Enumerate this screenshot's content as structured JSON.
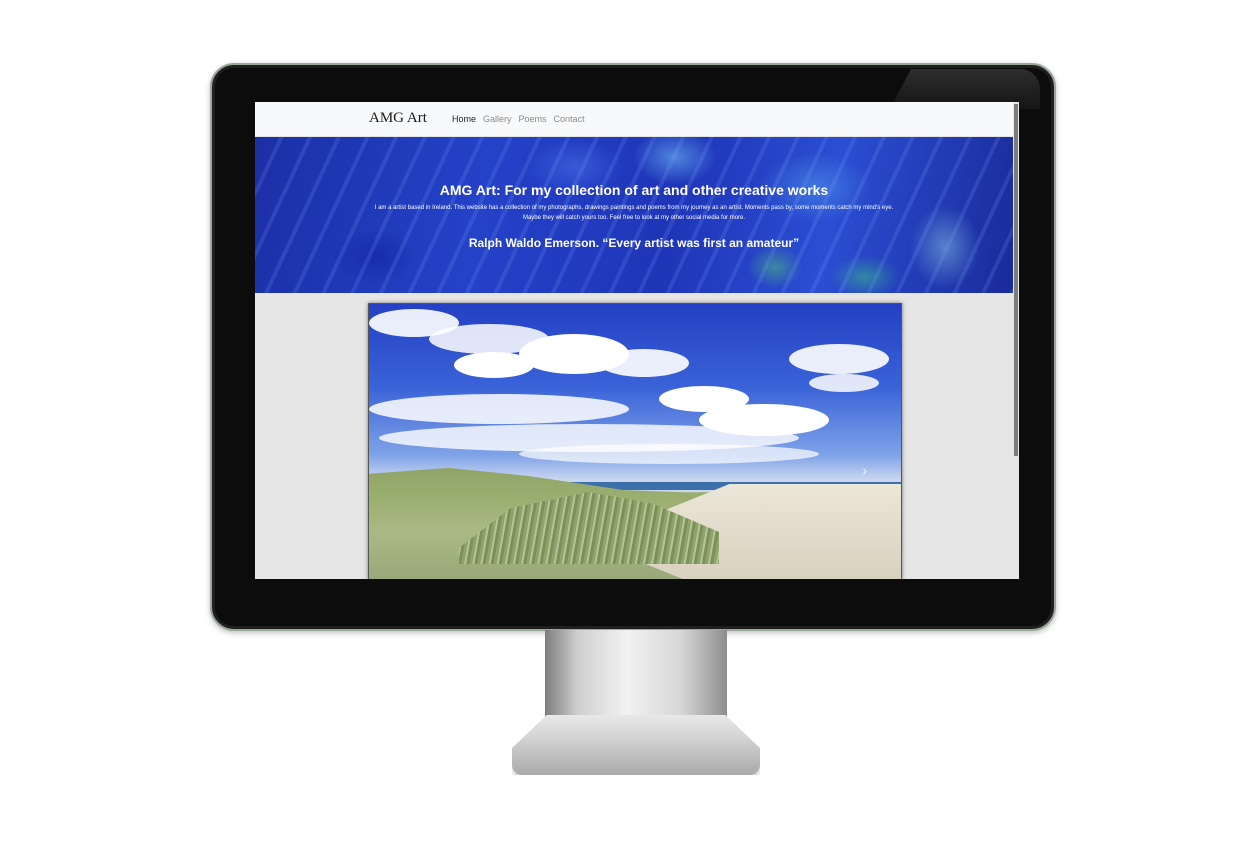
{
  "site": {
    "brand": "AMG Art",
    "nav": [
      {
        "label": "Home"
      },
      {
        "label": "Gallery"
      },
      {
        "label": "Poems"
      },
      {
        "label": "Contact"
      }
    ],
    "active_nav": "Home"
  },
  "hero": {
    "title": "AMG Art: For my collection of art and other creative works",
    "text": "I am a artist based in Ireland. This website has a collection of my photographs, drawings paintings and poems from my journey as an artist. Moments pass by, some moments catch my mind's eye. Maybe they will catch yours too. Feel free to look at my other social media for more.",
    "quote": "Ralph Waldo Emerson. “Every artist was first an amateur”"
  },
  "carousel": {
    "next_icon": "chevron-right-icon",
    "next_glyph": "›"
  },
  "colors": {
    "navbar_bg": "#f8f9fa",
    "hero_blue": "#2442c8",
    "page_bg": "#e6e6e6"
  }
}
